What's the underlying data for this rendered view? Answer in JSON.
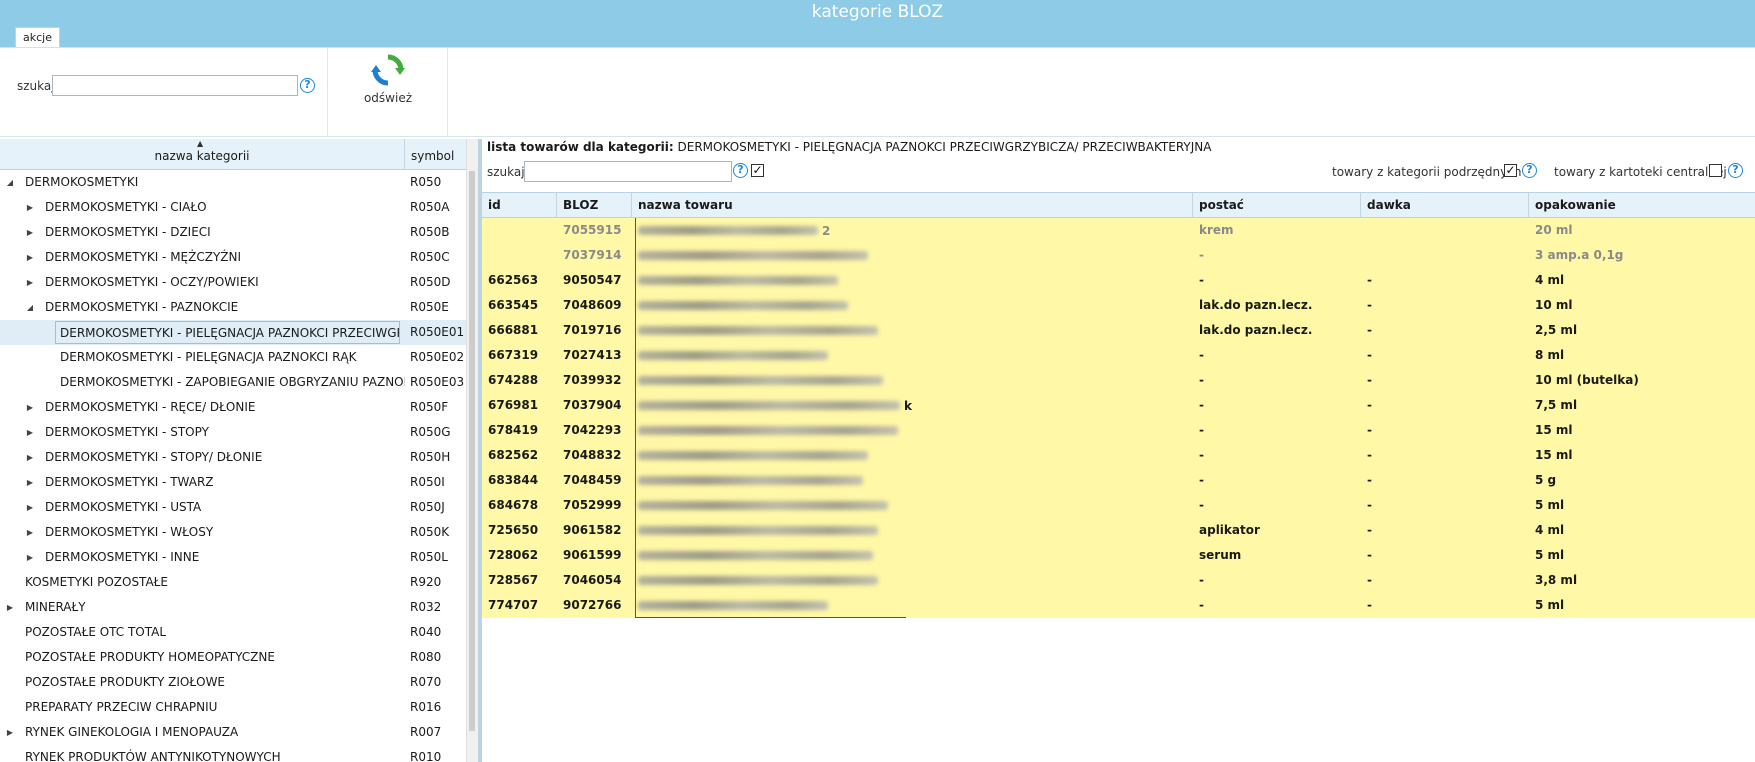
{
  "window": {
    "title": "kategorie BLOZ"
  },
  "ribbon": {
    "tab_label": "akcje",
    "search_label": "szukaj",
    "search_value": "",
    "help_symbol": "?",
    "refresh_label": "odśwież",
    "refresh_icon": "refresh-icon"
  },
  "tree": {
    "header_name": "nazwa kategorii",
    "header_symbol": "symbol",
    "sort_arrow": "▲",
    "rows": [
      {
        "name": "DERMOKOSMETYKI",
        "symbol": "R050",
        "level": 0,
        "expander": "◢"
      },
      {
        "name": "DERMOKOSMETYKI - CIAŁO",
        "symbol": "R050A",
        "level": 1,
        "expander": "▶"
      },
      {
        "name": "DERMOKOSMETYKI - DZIECI",
        "symbol": "R050B",
        "level": 1,
        "expander": "▶"
      },
      {
        "name": "DERMOKOSMETYKI - MĘŻCZYŹNI",
        "symbol": "R050C",
        "level": 1,
        "expander": "▶"
      },
      {
        "name": "DERMOKOSMETYKI - OCZY/POWIEKI",
        "symbol": "R050D",
        "level": 1,
        "expander": "▶"
      },
      {
        "name": "DERMOKOSMETYKI - PAZNOKCIE",
        "symbol": "R050E",
        "level": 1,
        "expander": "◢"
      },
      {
        "name": "DERMOKOSMETYKI - PIELĘGNACJA PAZNOKCI PRZECIWGRZY",
        "symbol": "R050E01",
        "level": 2,
        "expander": "",
        "selected": true
      },
      {
        "name": "DERMOKOSMETYKI - PIELĘGNACJA PAZNOKCI RĄK",
        "symbol": "R050E02",
        "level": 2,
        "expander": ""
      },
      {
        "name": "DERMOKOSMETYKI - ZAPOBIEGANIE OBGRYZANIU PAZNOKC",
        "symbol": "R050E03",
        "level": 2,
        "expander": ""
      },
      {
        "name": "DERMOKOSMETYKI - RĘCE/ DŁONIE",
        "symbol": "R050F",
        "level": 1,
        "expander": "▶"
      },
      {
        "name": "DERMOKOSMETYKI - STOPY",
        "symbol": "R050G",
        "level": 1,
        "expander": "▶"
      },
      {
        "name": "DERMOKOSMETYKI - STOPY/ DŁONIE",
        "symbol": "R050H",
        "level": 1,
        "expander": "▶"
      },
      {
        "name": "DERMOKOSMETYKI - TWARZ",
        "symbol": "R050I",
        "level": 1,
        "expander": "▶"
      },
      {
        "name": "DERMOKOSMETYKI - USTA",
        "symbol": "R050J",
        "level": 1,
        "expander": "▶"
      },
      {
        "name": "DERMOKOSMETYKI - WŁOSY",
        "symbol": "R050K",
        "level": 1,
        "expander": "▶"
      },
      {
        "name": "DERMOKOSMETYKI - INNE",
        "symbol": "R050L",
        "level": 1,
        "expander": "▶"
      },
      {
        "name": "KOSMETYKI POZOSTAŁE",
        "symbol": "R920",
        "level": 0,
        "expander": ""
      },
      {
        "name": "MINERAŁY",
        "symbol": "R032",
        "level": 0,
        "expander": "▶"
      },
      {
        "name": "POZOSTAŁE OTC TOTAL",
        "symbol": "R040",
        "level": 0,
        "expander": ""
      },
      {
        "name": "POZOSTAŁE PRODUKTY HOMEOPATYCZNE",
        "symbol": "R080",
        "level": 0,
        "expander": ""
      },
      {
        "name": "POZOSTAŁE PRODUKTY ZIOŁOWE",
        "symbol": "R070",
        "level": 0,
        "expander": ""
      },
      {
        "name": "PREPARATY PRZECIW CHRAPNIU",
        "symbol": "R016",
        "level": 0,
        "expander": ""
      },
      {
        "name": "RYNEK GINEKOLOGIA I MENOPAUZA",
        "symbol": "R007",
        "level": 0,
        "expander": "▶"
      },
      {
        "name": "RYNEK PRODUKTÓW ANTYNIKOTYNOWYCH",
        "symbol": "R010",
        "level": 0,
        "expander": ""
      }
    ]
  },
  "products": {
    "header_prefix": "lista towarów dla kategorii:",
    "category_name": "DERMOKOSMETYKI - PIELĘGNACJA PAZNOKCI PRZECIWGRZYBICZA/ PRZECIWBAKTERYJNA",
    "search_label": "szukaj",
    "search_value": "",
    "check_mark": "✓",
    "option_subcategories": "towary z kategorii podrzędnych",
    "option_central": "towary z kartoteki centralnej",
    "columns": [
      "id",
      "BLOZ",
      "nazwa towaru",
      "postać",
      "dawka",
      "opakowanie"
    ],
    "rows": [
      {
        "id": "",
        "bloz": "7055915",
        "name_tail": "2",
        "postac": "krem",
        "dawka": "",
        "opakowanie": "20 ml",
        "dim": true
      },
      {
        "id": "",
        "bloz": "7037914",
        "name_tail": "",
        "postac": "-",
        "dawka": "",
        "opakowanie": "3 amp.a 0,1g",
        "dim": true
      },
      {
        "id": "662563",
        "bloz": "9050547",
        "name_tail": "",
        "postac": "-",
        "dawka": "-",
        "opakowanie": "4 ml"
      },
      {
        "id": "663545",
        "bloz": "7048609",
        "name_tail": "",
        "postac": "lak.do pazn.lecz.",
        "dawka": "-",
        "opakowanie": "10 ml"
      },
      {
        "id": "666881",
        "bloz": "7019716",
        "name_tail": "",
        "postac": "lak.do pazn.lecz.",
        "dawka": "-",
        "opakowanie": "2,5 ml"
      },
      {
        "id": "667319",
        "bloz": "7027413",
        "name_tail": "",
        "postac": "-",
        "dawka": "-",
        "opakowanie": "8 ml"
      },
      {
        "id": "674288",
        "bloz": "7039932",
        "name_tail": "",
        "postac": "-",
        "dawka": "-",
        "opakowanie": "10 ml (butelka)"
      },
      {
        "id": "676981",
        "bloz": "7037904",
        "name_tail": "k",
        "postac": "-",
        "dawka": "-",
        "opakowanie": "7,5 ml"
      },
      {
        "id": "678419",
        "bloz": "7042293",
        "name_tail": "",
        "postac": "-",
        "dawka": "-",
        "opakowanie": "15 ml"
      },
      {
        "id": "682562",
        "bloz": "7048832",
        "name_tail": "",
        "postac": "-",
        "dawka": "-",
        "opakowanie": "15 ml"
      },
      {
        "id": "683844",
        "bloz": "7048459",
        "name_tail": "",
        "postac": "-",
        "dawka": "-",
        "opakowanie": "5 g"
      },
      {
        "id": "684678",
        "bloz": "7052999",
        "name_tail": "",
        "postac": "-",
        "dawka": "-",
        "opakowanie": "5 ml"
      },
      {
        "id": "725650",
        "bloz": "9061582",
        "name_tail": "",
        "postac": "aplikator",
        "dawka": "-",
        "opakowanie": "4 ml"
      },
      {
        "id": "728062",
        "bloz": "9061599",
        "name_tail": "",
        "postac": "serum",
        "dawka": "-",
        "opakowanie": "5 ml"
      },
      {
        "id": "728567",
        "bloz": "7046054",
        "name_tail": "",
        "postac": "-",
        "dawka": "-",
        "opakowanie": "3,8 ml"
      },
      {
        "id": "774707",
        "bloz": "9072766",
        "name_tail": "",
        "postac": "-",
        "dawka": "-",
        "opakowanie": "5 ml"
      }
    ]
  },
  "colors": {
    "titlebar": "#8ecbe6",
    "row_highlight": "#fff8a6",
    "header_bg": "#e6f2f9",
    "accent_blue": "#1e88d6"
  }
}
